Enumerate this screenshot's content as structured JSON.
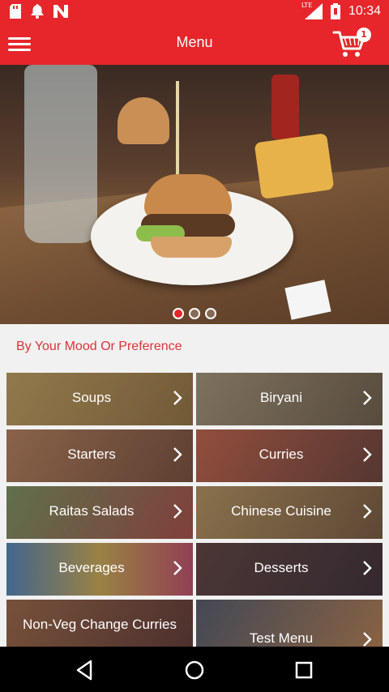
{
  "status_bar": {
    "time": "10:34",
    "network_label": "LTE",
    "icons": [
      "sd-card-icon",
      "notification-bell-icon",
      "app-n-icon",
      "signal-icon",
      "battery-icon"
    ]
  },
  "app_bar": {
    "title": "Menu",
    "cart_count": "1",
    "colors": {
      "primary": "#e6262b",
      "accent_text": "#e03236"
    }
  },
  "carousel": {
    "active_index": 0,
    "total": 3
  },
  "section": {
    "title": "By Your Mood Or Preference"
  },
  "categories": [
    {
      "label": "Soups",
      "tint": "#c8a24a"
    },
    {
      "label": "Biryani",
      "tint": "#9a8a5e"
    },
    {
      "label": "Starters",
      "tint": "#b77a4a"
    },
    {
      "label": "Curries",
      "tint": "#b9583a"
    },
    {
      "label": "Raitas Salads",
      "tint": "#6a8a4a"
    },
    {
      "label": "Chinese Cuisine",
      "tint": "#a9884c"
    },
    {
      "label": "Beverages",
      "tint": "#5a7ab0"
    },
    {
      "label": "Desserts",
      "tint": "#6a4e4a"
    },
    {
      "label": "Non-Veg Change Curries",
      "tint": "#8a5a3a"
    },
    {
      "label": "Test Menu",
      "tint": "#5a6a7a"
    }
  ]
}
